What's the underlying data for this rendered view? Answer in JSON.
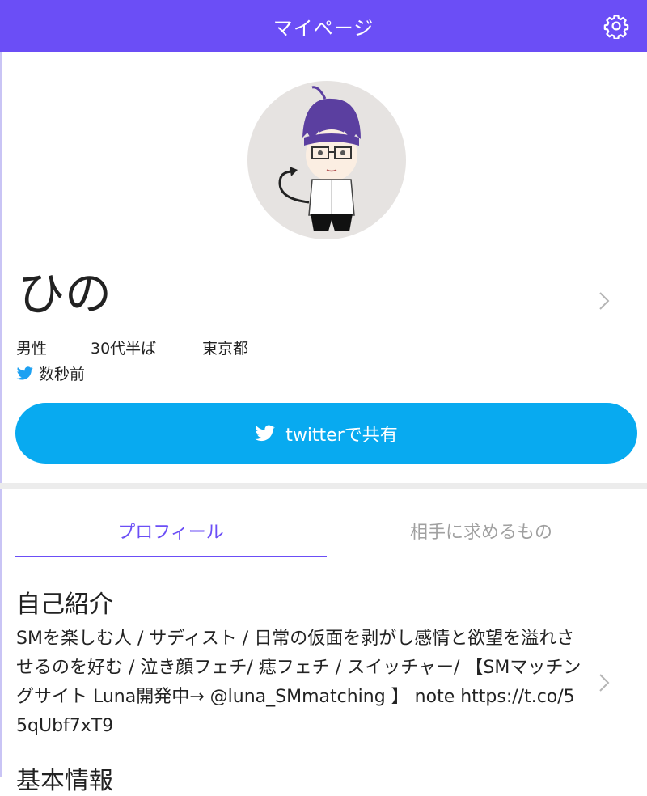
{
  "header": {
    "title": "マイページ",
    "settings_icon": "gear-icon"
  },
  "profile": {
    "name": "ひの",
    "gender": "男性",
    "age": "30代半ば",
    "location": "東京都",
    "last_login": "数秒前",
    "share_label": "twitterで共有"
  },
  "tabs": [
    {
      "label": "プロフィール",
      "active": true
    },
    {
      "label": "相手に求めるもの",
      "active": false
    }
  ],
  "sections": {
    "intro_title": "自己紹介",
    "intro_text": "SMを楽しむ人 / サディスト / 日常の仮面を剥がし感情と欲望を溢れさせるのを好む / 泣き顔フェチ/ 痣フェチ / スイッチャー/ 【SMマッチングサイト Luna開発中→ @luna_SMmatching 】 note https://t.co/55qUbf7xT9",
    "basic_title": "基本情報"
  },
  "colors": {
    "brand": "#6b4ef6",
    "twitter": "#08aaf0",
    "muted": "#a0a0a0"
  }
}
